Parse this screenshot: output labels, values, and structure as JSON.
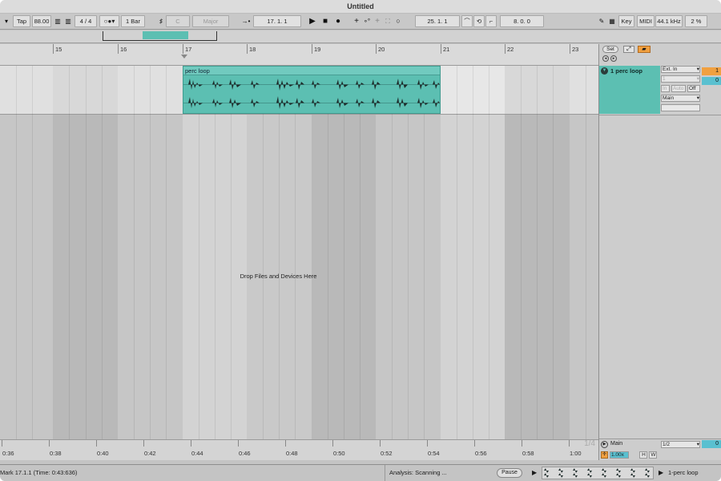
{
  "window": {
    "title": "Untitled"
  },
  "transport": {
    "tap_label": "Tap",
    "tempo": "88.00",
    "time_signature": "4 / 4",
    "metronome_icon": "metronome-icon",
    "quantize": "1 Bar",
    "key_root": "C",
    "scale": "Major",
    "arrangement_position": "17.   1.   1",
    "loop_start": "25.   1.   1",
    "loop_length": "8.   0.   0",
    "key_label": "Key",
    "midi_label": "MIDI",
    "sample_rate": "44.1 kHz",
    "cpu": "2 %"
  },
  "ruler": {
    "bars": [
      "15",
      "16",
      "17",
      "18",
      "19",
      "20",
      "21",
      "22",
      "23"
    ],
    "set_label": "Set"
  },
  "clip": {
    "name": "perc loop",
    "color": "#5cbfb2"
  },
  "arrangement": {
    "drop_hint": "Drop Files and Devices Here"
  },
  "timeline": {
    "times": [
      "0:36",
      "0:38",
      "0:40",
      "0:42",
      "0:44",
      "0:46",
      "0:48",
      "0:50",
      "0:52",
      "0:54",
      "0:56",
      "0:58",
      "1:00"
    ],
    "zoom": "1/4"
  },
  "track": {
    "name": "1 perc loop",
    "input_type": "Ext. In",
    "input_channel": "1",
    "monitor_in": "In",
    "monitor_auto": "Auto",
    "monitor_off": "Off",
    "output": "Main",
    "number_top": "1",
    "number_bottom": "0"
  },
  "main_track": {
    "name": "Main",
    "channel": "1/2",
    "value": "0",
    "tempo_rate": "1.00x",
    "h_label": "H",
    "w_label": "W"
  },
  "status": {
    "text": "Mark 17.1.1 (Time: 0:43:636)",
    "analysis": "Analysis: Scanning ...",
    "pause": "Pause",
    "clip_name": "1-perc loop"
  },
  "colors": {
    "accent_teal": "#5cbfb2",
    "accent_orange": "#f0a040",
    "accent_blue": "#5ac0d0"
  }
}
